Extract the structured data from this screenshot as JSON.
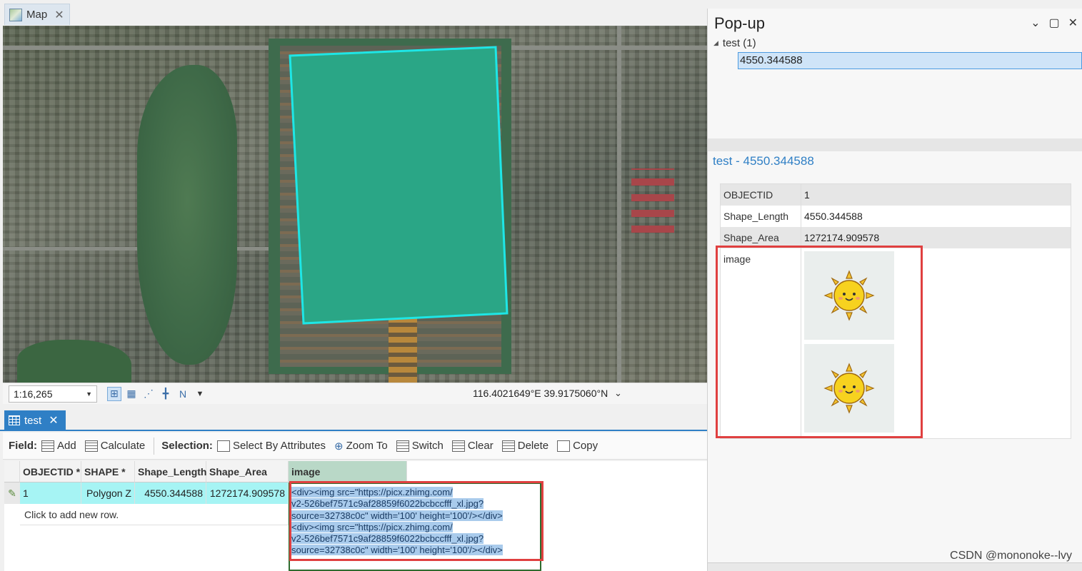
{
  "map_tab": {
    "label": "Map"
  },
  "map_status": {
    "scale": "1:16,265",
    "coordinates": "116.4021649°E 39.9175060°N"
  },
  "table_tab": {
    "label": "test"
  },
  "toolbar": {
    "field_label": "Field:",
    "add": "Add",
    "calculate": "Calculate",
    "selection_label": "Selection:",
    "select_by_attributes": "Select By Attributes",
    "zoom_to": "Zoom To",
    "switch": "Switch",
    "clear": "Clear",
    "delete": "Delete",
    "copy": "Copy"
  },
  "table": {
    "columns": [
      "OBJECTID *",
      "SHAPE *",
      "Shape_Length",
      "Shape_Area",
      "image"
    ],
    "row": {
      "objectid": "1",
      "shape": "Polygon Z",
      "shape_length": "4550.344588",
      "shape_area": "1272174.909578",
      "image_lines": [
        "<div><img src=\"https://picx.zhimg.com/",
        "v2-526bef7571c9af28859f6022bcbccfff_xl.jpg?",
        "source=32738c0c\" width='100' height='100'/></div>",
        "<div><img src=\"https://picx.zhimg.com/",
        "v2-526bef7571c9af28859f6022bcbccfff_xl.jpg?",
        "source=32738c0c\" width='100' height='100'/></div>"
      ]
    },
    "new_row": "Click to add new row."
  },
  "popup": {
    "title": "Pop-up",
    "tree_root": "test  (1)",
    "tree_item": "4550.344588",
    "feature_title": "test - 4550.344588",
    "fields": [
      {
        "key": "OBJECTID",
        "value": "1"
      },
      {
        "key": "Shape_Length",
        "value": "4550.344588"
      },
      {
        "key": "Shape_Area",
        "value": "1272174.909578"
      }
    ],
    "image_label": "image"
  },
  "watermark": "CSDN @mononoke--lvy",
  "colors": {
    "accent_blue": "#2f7fc5",
    "polygon_fill": "#2aa686",
    "polygon_outline": "#1ee6e6",
    "annotation_red": "#e04040",
    "row_highlight": "#a6f4f4"
  }
}
